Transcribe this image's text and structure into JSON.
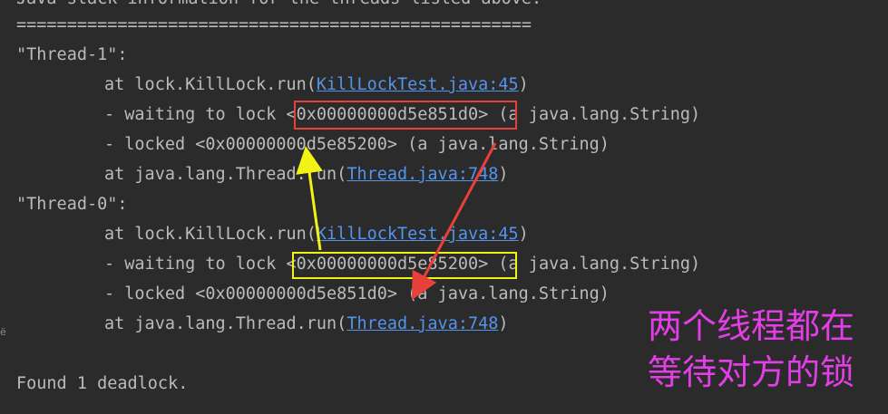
{
  "console": {
    "header_partial": "Java stack information for the threads listed above:",
    "separator": "===================================================",
    "thread1": {
      "name": "\"Thread-1\":",
      "frame1_prefix": "at lock.KillLock.run(",
      "frame1_link": "KillLockTest.java:45",
      "frame1_suffix": ")",
      "waiting_prefix": "- waiting to lock ",
      "waiting_addr": "<0x00000000d5e851d0>",
      "waiting_suffix": " (a java.lang.String)",
      "locked": "- locked <0x00000000d5e85200> (a java.lang.String)",
      "frame2_prefix": "at java.lang.Thread.run(",
      "frame2_link": "Thread.java:748",
      "frame2_suffix": ")"
    },
    "thread0": {
      "name": "\"Thread-0\":",
      "frame1_prefix": "at lock.KillLock.run(",
      "frame1_link": "KillLockTest.java:45",
      "frame1_suffix": ")",
      "waiting_prefix": "- waiting to lock ",
      "waiting_addr": "<0x00000000d5e85200>",
      "waiting_suffix": " (a java.lang.String)",
      "locked": "- locked <0x00000000d5e851d0> (a java.lang.String)",
      "frame2_prefix": "at java.lang.Thread.run(",
      "frame2_link": "Thread.java:748",
      "frame2_suffix": ")"
    },
    "found": "Found 1 deadlock."
  },
  "annotation": {
    "line1": "两个线程都在",
    "line2": "等待对方的锁"
  },
  "gutter_glyph": "ё",
  "colors": {
    "background": "#2b2b2b",
    "text": "#bbbbbb",
    "link": "#5394ec",
    "red_box": "#e8413a",
    "yellow_box": "#f2f216",
    "annotation": "#e33ee6"
  }
}
